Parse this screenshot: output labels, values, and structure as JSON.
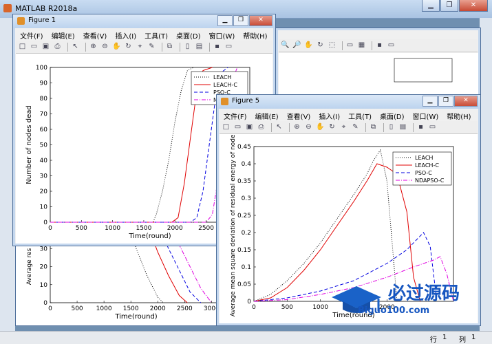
{
  "app": {
    "title": "MATLAB R2018a"
  },
  "status": {
    "row_label": "行",
    "row": "1",
    "col_label": "列",
    "col": "1"
  },
  "menus": [
    "文件(F)",
    "编辑(E)",
    "查看(V)",
    "插入(I)",
    "工具(T)",
    "桌面(D)",
    "窗口(W)",
    "帮助(H)"
  ],
  "figure1": {
    "title": "Figure 1"
  },
  "figure5": {
    "title": "Figure 5"
  },
  "watermark": {
    "cn": "必过源码",
    "url": "Biguo100.com"
  },
  "legend": [
    "LEACH",
    "LEACH-C",
    "PSO-C",
    "NDAPSO-C"
  ],
  "series_colors": {
    "LEACH": "#000000",
    "LEACH-C": "#e00000",
    "PSO-C": "#0000e0",
    "NDAPSO-C": "#e000e0"
  },
  "chart_data": [
    {
      "type": "line",
      "name": "fig1",
      "xlabel": "Time(round)",
      "ylabel": "Number of nodes dead",
      "xlim": [
        0,
        3200
      ],
      "ylim": [
        0,
        100
      ],
      "xticks": [
        0,
        500,
        1000,
        1500,
        2000,
        2500,
        3000
      ],
      "yticks": [
        0,
        10,
        20,
        30,
        40,
        50,
        60,
        70,
        80,
        90,
        100
      ],
      "series": [
        {
          "name": "LEACH",
          "x": [
            0,
            1650,
            1700,
            1800,
            1900,
            2000,
            2100,
            2200,
            2300
          ],
          "y": [
            0,
            0,
            5,
            20,
            40,
            65,
            85,
            98,
            100
          ]
        },
        {
          "name": "LEACH-C",
          "x": [
            0,
            1950,
            2050,
            2150,
            2250,
            2350,
            2450,
            2600
          ],
          "y": [
            0,
            0,
            3,
            25,
            55,
            85,
            98,
            100
          ]
        },
        {
          "name": "PSO-C",
          "x": [
            0,
            2250,
            2350,
            2450,
            2550,
            2650,
            2750,
            2850
          ],
          "y": [
            0,
            0,
            3,
            20,
            50,
            80,
            97,
            100
          ]
        },
        {
          "name": "NDAPSO-C",
          "x": [
            0,
            2500,
            2600,
            2700,
            2800,
            2900,
            3000
          ],
          "y": [
            0,
            0,
            5,
            30,
            65,
            90,
            100
          ]
        }
      ]
    },
    {
      "type": "line",
      "name": "fig1-lower",
      "xlabel": "Time(round)",
      "ylabel": "Average res",
      "xlim": [
        0,
        3200
      ],
      "ylim": [
        0,
        40
      ],
      "xticks": [
        0,
        500,
        1000,
        1500,
        2000,
        2500,
        3000
      ],
      "yticks": [
        0,
        10,
        20,
        30
      ],
      "series": [
        {
          "name": "LEACH",
          "x": [
            1500,
            1600,
            1800,
            2000,
            2100
          ],
          "y": [
            40,
            30,
            15,
            3,
            0
          ]
        },
        {
          "name": "LEACH-C",
          "x": [
            1850,
            2000,
            2200,
            2400,
            2550
          ],
          "y": [
            40,
            28,
            15,
            4,
            0
          ]
        },
        {
          "name": "PSO-C",
          "x": [
            2050,
            2200,
            2400,
            2600,
            2800
          ],
          "y": [
            40,
            30,
            18,
            6,
            0
          ]
        },
        {
          "name": "NDAPSO-C",
          "x": [
            2250,
            2400,
            2600,
            2800,
            3000
          ],
          "y": [
            40,
            32,
            20,
            8,
            0
          ]
        }
      ]
    },
    {
      "type": "line",
      "name": "fig5",
      "xlabel": "Time(round)",
      "ylabel": "Average mean square deviation of residual energy of nodes",
      "xlim": [
        0,
        3000
      ],
      "ylim": [
        0,
        0.45
      ],
      "xticks": [
        0,
        500,
        1000,
        1500,
        2000
      ],
      "yticks": [
        0,
        0.05,
        0.1,
        0.15,
        0.2,
        0.25,
        0.3,
        0.35,
        0.4,
        0.45
      ],
      "series": [
        {
          "name": "LEACH",
          "x": [
            0,
            250,
            500,
            750,
            1000,
            1250,
            1500,
            1700,
            1800,
            1900,
            2000,
            2100,
            2150
          ],
          "y": [
            0,
            0.02,
            0.06,
            0.11,
            0.17,
            0.24,
            0.31,
            0.37,
            0.41,
            0.44,
            0.35,
            0.12,
            0.0
          ]
        },
        {
          "name": "LEACH-C",
          "x": [
            0,
            250,
            500,
            750,
            1000,
            1250,
            1500,
            1700,
            1850,
            2000,
            2150,
            2300,
            2400,
            2500
          ],
          "y": [
            0,
            0.01,
            0.04,
            0.09,
            0.15,
            0.22,
            0.29,
            0.35,
            0.4,
            0.39,
            0.37,
            0.26,
            0.07,
            0.0
          ]
        },
        {
          "name": "PSO-C",
          "x": [
            0,
            500,
            1000,
            1500,
            2000,
            2300,
            2450,
            2550,
            2650,
            2750
          ],
          "y": [
            0,
            0.01,
            0.03,
            0.06,
            0.11,
            0.15,
            0.18,
            0.2,
            0.16,
            0.0
          ]
        },
        {
          "name": "NDAPSO-C",
          "x": [
            0,
            500,
            1000,
            1500,
            2000,
            2400,
            2700,
            2800,
            2900,
            3000
          ],
          "y": [
            0,
            0.005,
            0.02,
            0.04,
            0.07,
            0.1,
            0.12,
            0.13,
            0.08,
            0.0
          ]
        }
      ]
    }
  ]
}
